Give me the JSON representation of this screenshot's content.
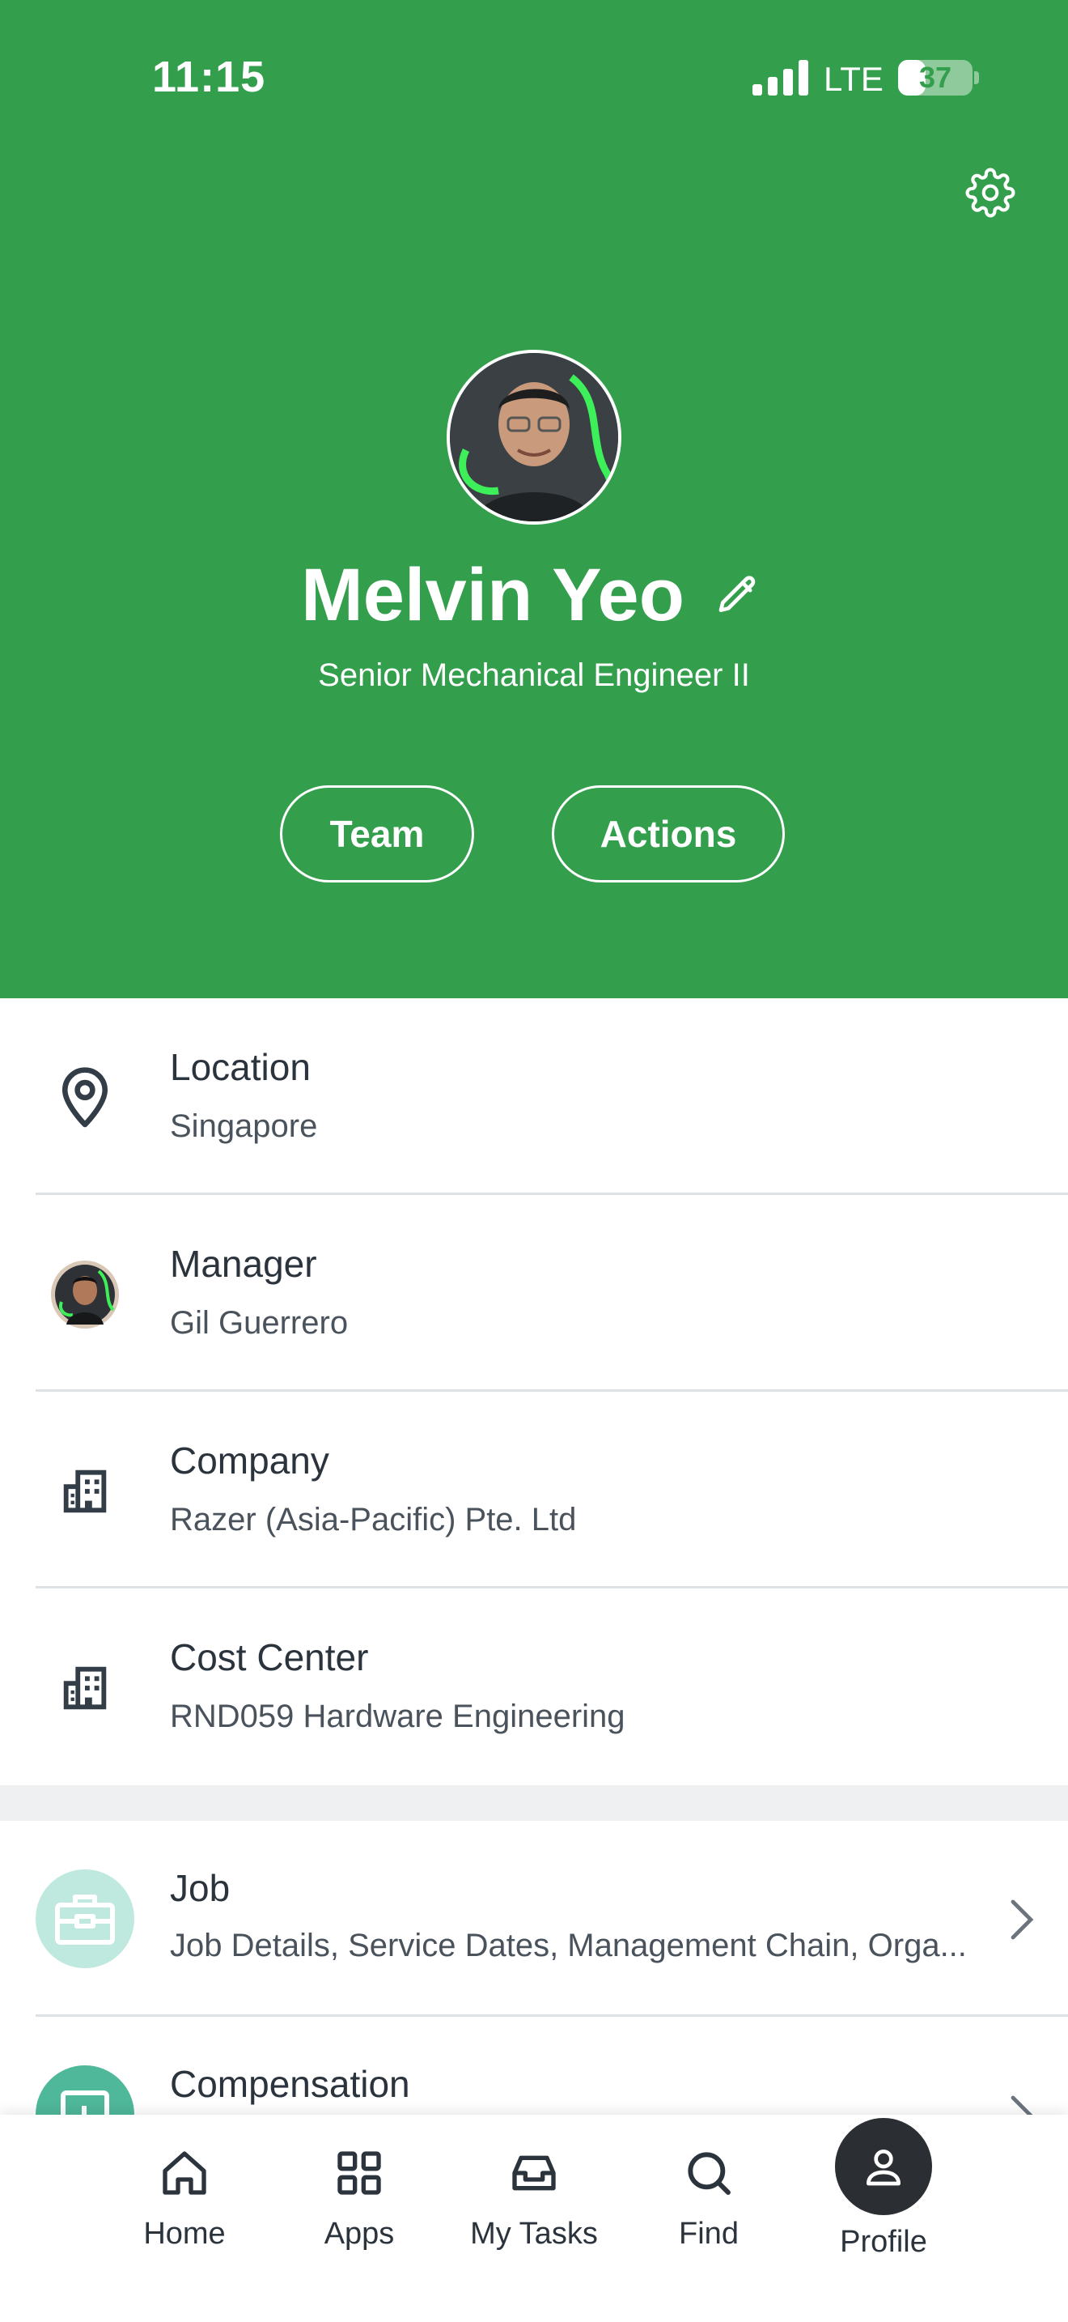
{
  "status_bar": {
    "time": "11:15",
    "network": "LTE",
    "battery_percent": 37,
    "battery_label": "37"
  },
  "profile": {
    "name": "Melvin Yeo",
    "title": "Senior Mechanical Engineer II",
    "buttons": {
      "team": "Team",
      "actions": "Actions"
    }
  },
  "info": [
    {
      "label": "Location",
      "value": "Singapore",
      "icon": "location-pin-icon"
    },
    {
      "label": "Manager",
      "value": "Gil Guerrero",
      "icon": "manager-avatar"
    },
    {
      "label": "Company",
      "value": "Razer (Asia-Pacific) Pte. Ltd",
      "icon": "building-icon"
    },
    {
      "label": "Cost Center",
      "value": "RND059 Hardware Engineering",
      "icon": "building-icon"
    }
  ],
  "sections": [
    {
      "label": "Job",
      "value": "Job Details, Service Dates, Management Chain, Orga...",
      "icon": "briefcase-icon",
      "color": "#bfe9de"
    },
    {
      "label": "Compensation",
      "value": "",
      "icon": "chart-icon",
      "color": "#4fb79a"
    }
  ],
  "tabbar": {
    "home": "Home",
    "apps": "Apps",
    "tasks": "My Tasks",
    "find": "Find",
    "profile": "Profile"
  },
  "colors": {
    "brand_green": "#339e4c",
    "text_dark": "#2b343d"
  }
}
